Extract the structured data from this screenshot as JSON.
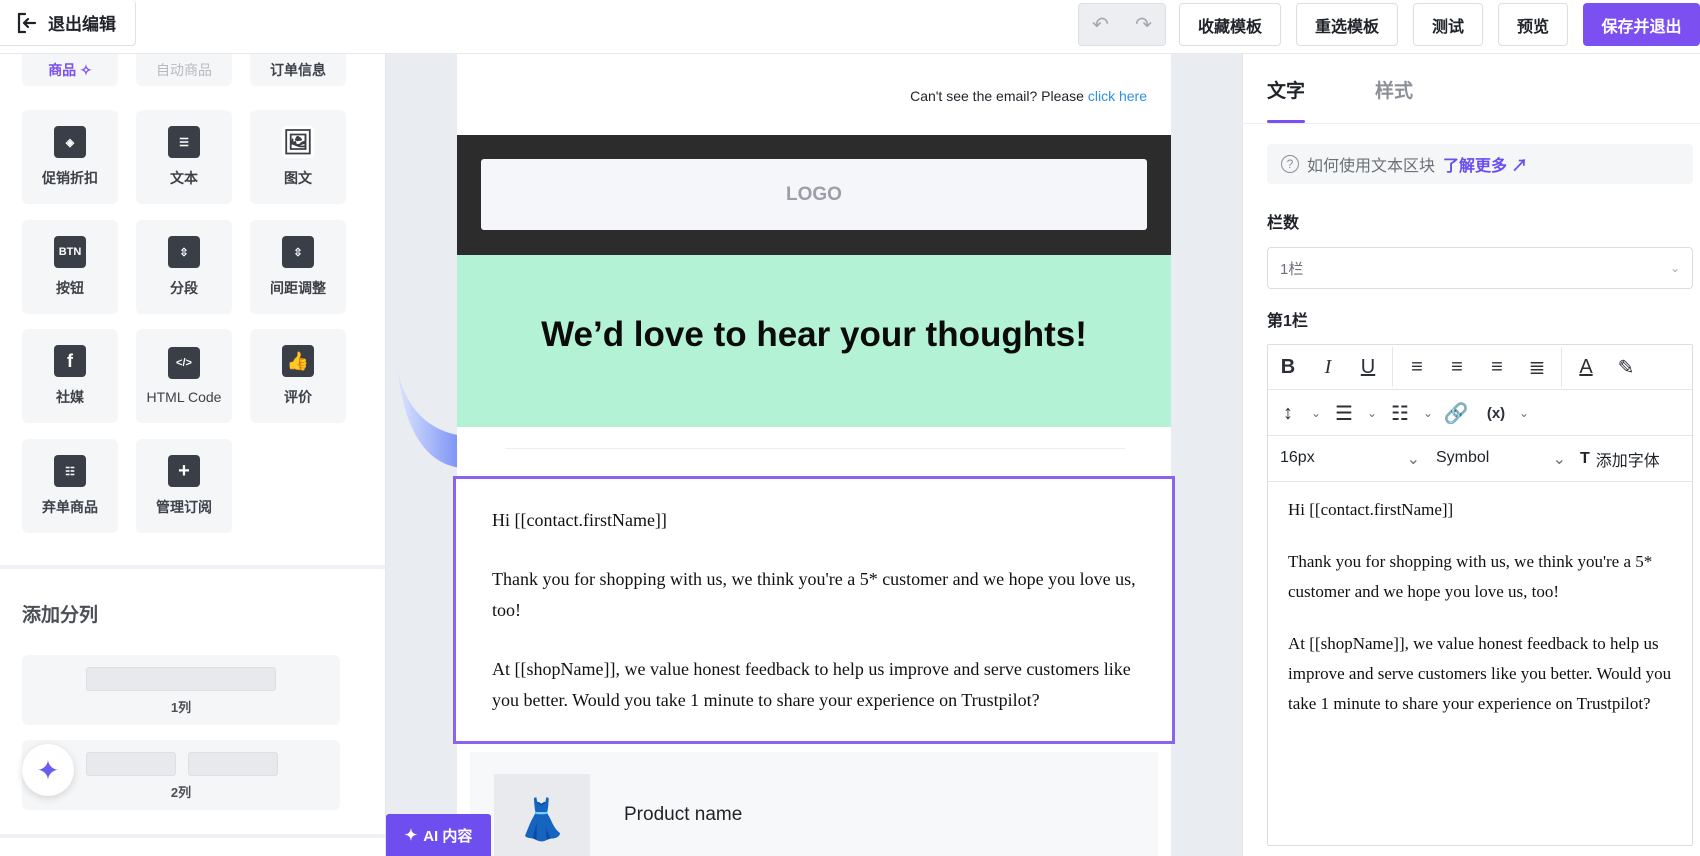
{
  "topbar": {
    "exit_label": "退出编辑",
    "buttons": {
      "favorite": "收藏模板",
      "reselect": "重选模板",
      "test": "测试",
      "preview": "预览",
      "save_exit": "保存并退出"
    }
  },
  "left": {
    "row0": [
      {
        "label": "商品",
        "icon": "sparkle-icon",
        "state": "active"
      },
      {
        "label": "自动商品",
        "state": "disabled"
      },
      {
        "label": "订单信息",
        "state": "normal"
      }
    ],
    "blocks": [
      {
        "label": "促销折扣",
        "icon": "tag-icon"
      },
      {
        "label": "文本",
        "icon": "text-icon"
      },
      {
        "label": "图文",
        "icon": "image-text-icon"
      },
      {
        "label": "按钮",
        "icon": "button-icon",
        "icon_text": "BTN"
      },
      {
        "label": "分段",
        "icon": "divider-icon"
      },
      {
        "label": "间距调整",
        "icon": "spacing-icon"
      },
      {
        "label": "社媒",
        "icon": "facebook-icon",
        "icon_text": "f"
      },
      {
        "label": "HTML Code",
        "icon": "code-icon",
        "icon_text": "</>"
      },
      {
        "label": "评价",
        "icon": "thumbs-up-icon"
      },
      {
        "label": "弃单商品",
        "icon": "abandoned-cart-icon"
      },
      {
        "label": "管理订阅",
        "icon": "bookmark-plus-icon"
      }
    ],
    "columns_title": "添加分列",
    "col1_label": "1列",
    "col2_label": "2列"
  },
  "email": {
    "cant_see": "Can't see the email? Please ",
    "click_here": "click here",
    "logo": "LOGO",
    "hero_title": "We’d love to hear your thoughts!",
    "paragraphs": [
      "Hi [[contact.firstName]]",
      "Thank you for shopping with us, we think you're a 5* customer and we hope you love us, too!",
      "At [[shopName]], we value honest feedback to help us improve and serve customers like you better. Would you take 1 minute to share your experience on Trustpilot?"
    ],
    "product_name": "Product name",
    "ai_tab": "AI 内容"
  },
  "right": {
    "tabs": [
      "文字",
      "样式"
    ],
    "help_text": "如何使用文本区块",
    "learn_more": "了解更多",
    "columns_label": "栏数",
    "columns_value": "1栏",
    "col1_section": "第1栏",
    "font_size": "16px",
    "font_family": "Symbol",
    "add_font": "添加字体",
    "editor_paragraphs": [
      "Hi [[contact.firstName]]",
      "Thank you for shopping with us, we think you're a 5* customer and we hope you love us, too!",
      "At [[shopName]], we value honest feedback to help us improve and serve customers like you better. Would you take 1 minute to share your experience on Trustpilot?"
    ]
  },
  "colors": {
    "accent": "#7b4ff0",
    "hero_bg": "#b3f2d4",
    "logo_band": "#2c2c2c",
    "link": "#2f8ee6"
  }
}
